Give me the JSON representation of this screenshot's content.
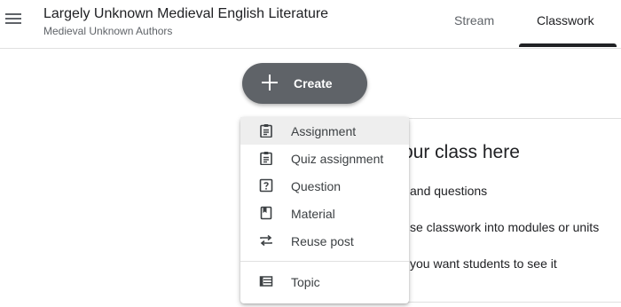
{
  "header": {
    "class_title": "Largely Unknown Medieval English Literature",
    "class_subtitle": "Medieval Unknown Authors",
    "menu_icon": "hamburger-menu-icon",
    "tabs": [
      {
        "label": "Stream",
        "active": false
      },
      {
        "label": "Classwork",
        "active": true
      }
    ]
  },
  "create_button": {
    "label": "Create",
    "icon": "plus-icon"
  },
  "create_menu": {
    "items": [
      {
        "label": "Assignment",
        "icon": "assignment-icon",
        "highlighted": true
      },
      {
        "label": "Quiz assignment",
        "icon": "quiz-assignment-icon"
      },
      {
        "label": "Question",
        "icon": "question-icon"
      },
      {
        "label": "Material",
        "icon": "material-icon"
      },
      {
        "label": "Reuse post",
        "icon": "reuse-post-icon"
      },
      {
        "label": "Topic",
        "icon": "topic-icon"
      }
    ]
  },
  "background_card": {
    "heading": "our class here",
    "lines": [
      "and questions",
      "se classwork into modules or units",
      "you want students to see it"
    ]
  },
  "colors": {
    "create_button_bg": "#5f6368",
    "menu_highlight": "#eeeeee",
    "icon": "#3c4043"
  }
}
